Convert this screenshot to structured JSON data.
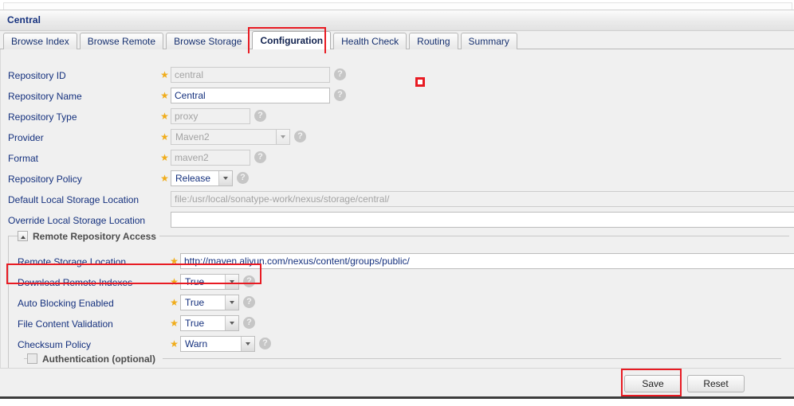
{
  "panel": {
    "title": "Central"
  },
  "tabs": [
    {
      "label": "Browse Index",
      "active": false
    },
    {
      "label": "Browse Remote",
      "active": false
    },
    {
      "label": "Browse Storage",
      "active": false
    },
    {
      "label": "Configuration",
      "active": true
    },
    {
      "label": "Health Check",
      "active": false
    },
    {
      "label": "Routing",
      "active": false
    },
    {
      "label": "Summary",
      "active": false
    }
  ],
  "form": {
    "repository_id": {
      "label": "Repository ID",
      "value": "central",
      "readonly": true,
      "required": true
    },
    "repository_name": {
      "label": "Repository Name",
      "value": "Central",
      "readonly": false,
      "required": true
    },
    "repository_type": {
      "label": "Repository Type",
      "value": "proxy",
      "readonly": true,
      "required": true
    },
    "provider": {
      "label": "Provider",
      "value": "Maven2",
      "readonly": true,
      "required": true
    },
    "format": {
      "label": "Format",
      "value": "maven2",
      "readonly": true,
      "required": true
    },
    "repository_policy": {
      "label": "Repository Policy",
      "value": "Release",
      "readonly": false,
      "required": true
    },
    "default_local_storage_location": {
      "label": "Default Local Storage Location",
      "value": "file:/usr/local/sonatype-work/nexus/storage/central/",
      "readonly": true,
      "required": false
    },
    "override_local_storage_location": {
      "label": "Override Local Storage Location",
      "value": "",
      "readonly": false,
      "required": false
    }
  },
  "remote_section": {
    "title": "Remote Repository Access",
    "collapse_icon": "chevron-up-icon",
    "remote_storage_location": {
      "label": "Remote Storage Location",
      "value": "http://maven.aliyun.com/nexus/content/groups/public/",
      "required": true
    },
    "download_remote_indexes": {
      "label": "Download Remote Indexes",
      "value": "True",
      "required": true
    },
    "auto_blocking_enabled": {
      "label": "Auto Blocking Enabled",
      "value": "True",
      "required": true
    },
    "file_content_validation": {
      "label": "File Content Validation",
      "value": "True",
      "required": true
    },
    "checksum_policy": {
      "label": "Checksum Policy",
      "value": "Warn",
      "required": true
    }
  },
  "authentication_section": {
    "label": "Authentication (optional)",
    "checked": false
  },
  "buttons": {
    "save": "Save",
    "reset": "Reset"
  },
  "icons": {
    "help": "?",
    "star": "★"
  },
  "annotations": {
    "highlight_color": "#e81b23",
    "items": [
      "configuration-tab-highlight",
      "download-remote-indexes-highlight",
      "save-button-highlight",
      "red-square-marker"
    ]
  }
}
